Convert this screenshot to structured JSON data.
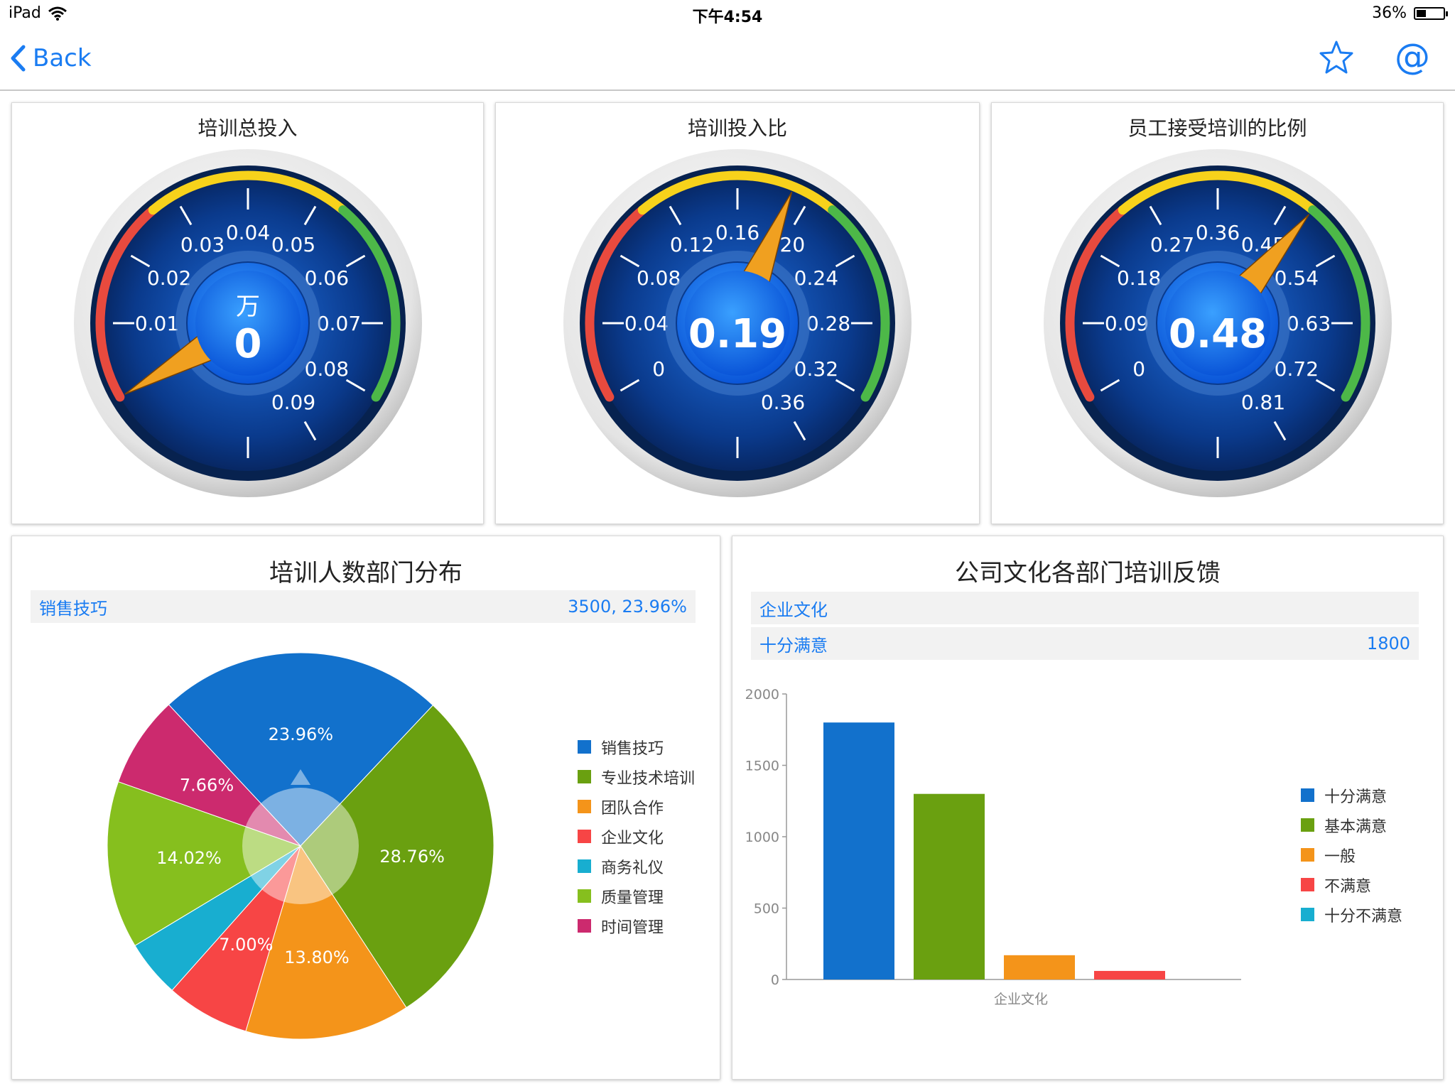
{
  "status_bar": {
    "device": "iPad",
    "time": "下午4:54",
    "battery": "36%",
    "battery_level": 0.36
  },
  "nav": {
    "back_label": "Back",
    "star_icon": "star-icon",
    "at_icon": "at-sign-icon",
    "accent": "#1a7cf2"
  },
  "gauges": [
    {
      "title": "培训总投入",
      "unit": "万",
      "value_label": "0",
      "value": 0,
      "ticks": [
        "0.01",
        "0.02",
        "0.03",
        "0.04",
        "0.05",
        "0.06",
        "0.07",
        "0.08",
        "0.09"
      ]
    },
    {
      "title": "培训投入比",
      "unit": "",
      "value_label": "0.19",
      "value": 0.19,
      "ticks": [
        "0",
        "0.04",
        "0.08",
        "0.12",
        "0.16",
        "0.20",
        "0.24",
        "0.28",
        "0.32",
        "0.36"
      ]
    },
    {
      "title": "员工接受培训的比例",
      "unit": "",
      "value_label": "0.48",
      "value": 0.48,
      "ticks": [
        "0",
        "0.09",
        "0.18",
        "0.27",
        "0.36",
        "0.45",
        "0.54",
        "0.63",
        "0.72",
        "0.81"
      ]
    }
  ],
  "gauge_colors": {
    "low": "#e84a3e",
    "mid": "#f7d21b",
    "high": "#4db848",
    "face": "#0a3a8c",
    "needle": "#f0a020"
  },
  "pie": {
    "title": "培训人数部门分布",
    "tooltip": {
      "label": "销售技巧",
      "value": "3500, 23.96%"
    },
    "legend": [
      "销售技巧",
      "专业技术培训",
      "团队合作",
      "企业文化",
      "商务礼仪",
      "质量管理",
      "时间管理"
    ],
    "labels": [
      "23.96%",
      "28.76%",
      "13.80%",
      "7.00%",
      "",
      "14.02%",
      "7.66%"
    ]
  },
  "bar": {
    "title": "公司文化各部门培训反馈",
    "tooltip": {
      "category": "企业文化",
      "series": "十分满意",
      "value": "1800"
    },
    "legend": [
      "十分满意",
      "基本满意",
      "一般",
      "不满意",
      "十分不满意"
    ],
    "y_ticks": [
      "2000",
      "1500",
      "1000",
      "500",
      "0"
    ],
    "x_label": "企业文化"
  },
  "chart_data": [
    {
      "type": "pie",
      "title": "培训人数部门分布",
      "categories": [
        "销售技巧",
        "专业技术培训",
        "团队合作",
        "企业文化",
        "商务礼仪",
        "质量管理",
        "时间管理"
      ],
      "values": [
        23.96,
        28.76,
        13.8,
        7.0,
        4.8,
        14.02,
        7.66
      ],
      "colors": [
        "#1271cc",
        "#6aa010",
        "#f4941a",
        "#f74545",
        "#18aed0",
        "#86bf1e",
        "#cc2a6e"
      ],
      "legend": "right"
    },
    {
      "type": "bar",
      "title": "公司文化各部门培训反馈",
      "categories": [
        "企业文化"
      ],
      "series": [
        {
          "name": "十分满意",
          "values": [
            1800
          ]
        },
        {
          "name": "基本满意",
          "values": [
            1300
          ]
        },
        {
          "name": "一般",
          "values": [
            170
          ]
        },
        {
          "name": "不满意",
          "values": [
            60
          ]
        },
        {
          "name": "十分不满意",
          "values": [
            0
          ]
        }
      ],
      "colors": [
        "#1271cc",
        "#6aa010",
        "#f4941a",
        "#f74545",
        "#18aed0"
      ],
      "ylim": [
        0,
        2000
      ],
      "legend": "right"
    }
  ]
}
